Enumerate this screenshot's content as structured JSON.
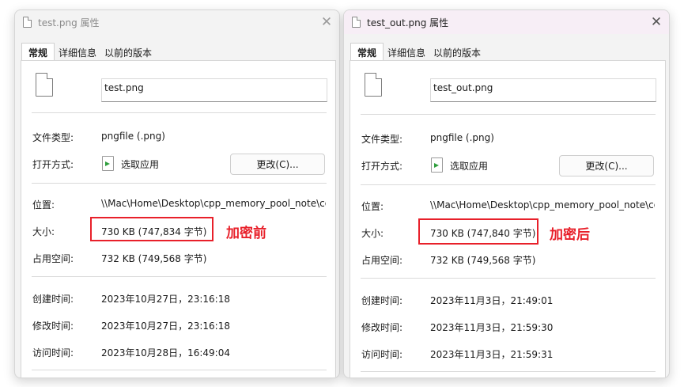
{
  "left": {
    "title": "test.png 属性",
    "close": "✕",
    "tabs": [
      "常规",
      "详细信息",
      "以前的版本"
    ],
    "filename": "test.png",
    "file_type_label": "文件类型:",
    "file_type_value": "pngfile (.png)",
    "open_with_label": "打开方式:",
    "open_with_app": "选取应用",
    "change_button": "更改(C)...",
    "location_label": "位置:",
    "location_value": "\\\\Mac\\Home\\Desktop\\cpp_memory_pool_note\\code",
    "size_label": "大小:",
    "size_value": "730 KB (747,834 字节)",
    "size_on_disk_label": "占用空间:",
    "size_on_disk_value": "732 KB (749,568 字节)",
    "created_label": "创建时间:",
    "created_value": "2023年10月27日，23:16:18",
    "modified_label": "修改时间:",
    "modified_value": "2023年10月27日，23:16:18",
    "accessed_label": "访问时间:",
    "accessed_value": "2023年10月28日，16:49:04",
    "annotation": "加密前"
  },
  "right": {
    "title": "test_out.png 属性",
    "close": "✕",
    "tabs": [
      "常规",
      "详细信息",
      "以前的版本"
    ],
    "filename": "test_out.png",
    "file_type_label": "文件类型:",
    "file_type_value": "pngfile (.png)",
    "open_with_label": "打开方式:",
    "open_with_app": "选取应用",
    "change_button": "更改(C)...",
    "location_label": "位置:",
    "location_value": "\\\\Mac\\Home\\Desktop\\cpp_memory_pool_note\\code",
    "size_label": "大小:",
    "size_value": "730 KB (747,840 字节)",
    "size_on_disk_label": "占用空间:",
    "size_on_disk_value": "732 KB (749,568 字节)",
    "created_label": "创建时间:",
    "created_value": "2023年11月3日，21:49:01",
    "modified_label": "修改时间:",
    "modified_value": "2023年11月3日，21:59:30",
    "accessed_label": "访问时间:",
    "accessed_value": "2023年11月3日，21:59:31",
    "annotation": "加密后"
  },
  "colors": {
    "annotation_red": "#e8202a",
    "open_with_arrow": "#2e9e3c"
  }
}
